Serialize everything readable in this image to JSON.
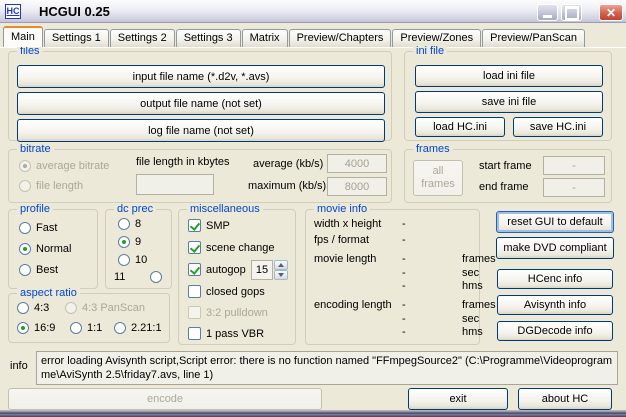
{
  "window": {
    "title": "HCGUI 0.25",
    "icon_text": "HC"
  },
  "tabs": [
    "Main",
    "Settings 1",
    "Settings 2",
    "Settings 3",
    "Matrix",
    "Preview/Chapters",
    "Preview/Zones",
    "Preview/PanScan"
  ],
  "active_tab": "Main",
  "files": {
    "legend": "files",
    "buttons": [
      "input file name (*.d2v, *.avs)",
      "output file name (not set)",
      "log file name (not set)"
    ]
  },
  "ini_file": {
    "legend": "ini file",
    "load_ini": "load ini file",
    "save_ini": "save ini file",
    "load_hc": "load HC.ini",
    "save_hc": "save HC.ini"
  },
  "bitrate": {
    "legend": "bitrate",
    "radio_average": "average bitrate",
    "radio_file_length": "file length",
    "selected": "average bitrate",
    "file_length_label": "file length in kbytes",
    "file_length_value": "",
    "average_label": "average (kb/s)",
    "average_value": "4000",
    "maximum_label": "maximum (kb/s)",
    "maximum_value": "8000"
  },
  "frames": {
    "legend": "frames",
    "all_frames_button": "all frames",
    "start_label": "start frame",
    "start_value": "-",
    "end_label": "end frame",
    "end_value": "-"
  },
  "profile": {
    "legend": "profile",
    "options": [
      "Fast",
      "Normal",
      "Best"
    ],
    "selected": "Normal"
  },
  "dc_prec": {
    "legend": "dc prec",
    "options": [
      "8",
      "9",
      "10",
      "11"
    ],
    "selected": "9"
  },
  "misc": {
    "legend": "miscellaneous",
    "smp": "SMP",
    "scene_change": "scene change",
    "autogop": "autogop",
    "autogop_value": "15",
    "closed_gops": "closed gops",
    "pulldown": "3:2 pulldown",
    "one_pass_vbr": "1 pass VBR",
    "checked": [
      "SMP",
      "scene change",
      "autogop"
    ],
    "disabled": [
      "3:2 pulldown"
    ]
  },
  "movie_info": {
    "legend": "movie info",
    "rows": [
      {
        "label": "width x height",
        "value": "-",
        "unit": ""
      },
      {
        "label": "fps / format",
        "value": "-",
        "unit": ""
      },
      {
        "label": "movie length",
        "value": "-",
        "unit": "frames"
      },
      {
        "label": "",
        "value": "-",
        "unit": "sec"
      },
      {
        "label": "",
        "value": "-",
        "unit": "hms"
      },
      {
        "label": "encoding length",
        "value": "-",
        "unit": "frames"
      },
      {
        "label": "",
        "value": "-",
        "unit": "sec"
      },
      {
        "label": "",
        "value": "-",
        "unit": "hms"
      }
    ]
  },
  "aspect_ratio": {
    "legend": "aspect ratio",
    "options": [
      "4:3",
      "4:3 PanScan",
      "16:9",
      "1:1",
      "2.21:1"
    ],
    "selected": "16:9",
    "disabled": [
      "4:3 PanScan"
    ]
  },
  "side_buttons": [
    "reset GUI to default",
    "make DVD compliant",
    "HCenc info",
    "Avisynth info",
    "DGDecode info"
  ],
  "info": {
    "label": "info",
    "text": "error loading Avisynth script,Script error: there is no function named \"FFmpegSource2\" (C:\\Programme\\Videoprogramme\\AviSynth 2.5\\friday7.avs, line 1)"
  },
  "bottom": {
    "encode": "encode",
    "exit": "exit",
    "about": "about HC"
  },
  "colors": {
    "legend_blue": "#0046D5",
    "button_border": "#003C74",
    "disabled_text": "#ACA899",
    "check_green": "#21A121",
    "tab_accent_orange": "#E68B2C",
    "close_red": "#C94F3D",
    "window_bg": "#ECE9D8"
  }
}
